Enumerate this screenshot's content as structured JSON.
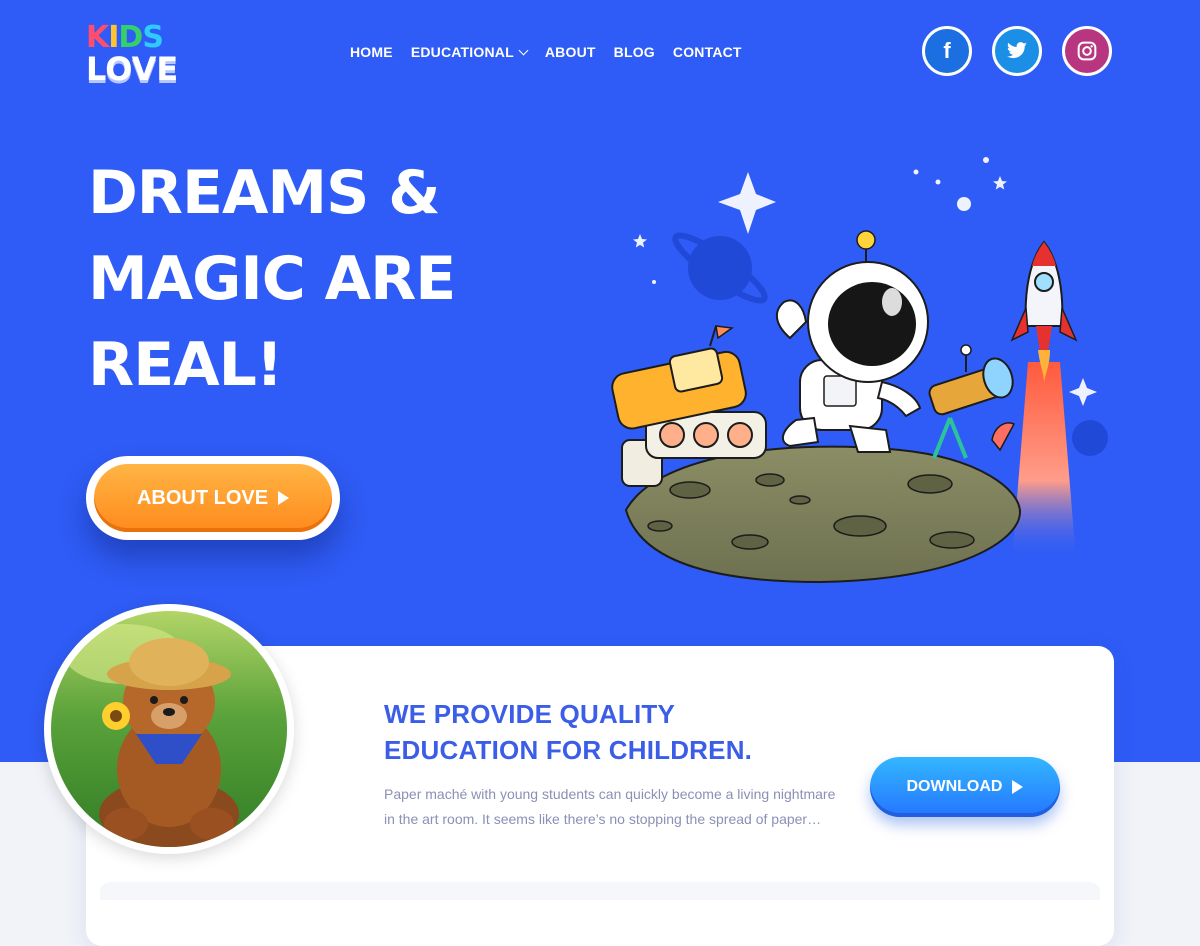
{
  "logo": {
    "line1": "KIDS",
    "line2": "LOVE",
    "line1_letter_colors": [
      "#ff4d6d",
      "#ffc42e",
      "#35d06b",
      "#2ecbff"
    ]
  },
  "nav": {
    "items": [
      "HOME",
      "EDUCATIONAL",
      "ABOUT",
      "BLOG",
      "CONTACT"
    ]
  },
  "social": {
    "facebook_glyph": "f",
    "twitter_icon": "twitter-bird-icon",
    "instagram_icon": "instagram-icon"
  },
  "hero": {
    "headline_lines": [
      "DREAMS &",
      "MAGIC ARE",
      "REAL!"
    ],
    "cta_label": "ABOUT LOVE"
  },
  "card": {
    "title_lines": [
      "WE PROVIDE QUALITY",
      "EDUCATION FOR CHILDREN."
    ],
    "text": "Paper maché with young students can quickly become a living nightmare in the art room. It seems like there’s no stopping the spread of paper…",
    "button_label": "DOWNLOAD"
  },
  "colors": {
    "hero_bg": "#2f5cf6",
    "title_blue": "#3b5de7",
    "orange": "#ff9a2e",
    "text_muted": "#8b90b5"
  }
}
